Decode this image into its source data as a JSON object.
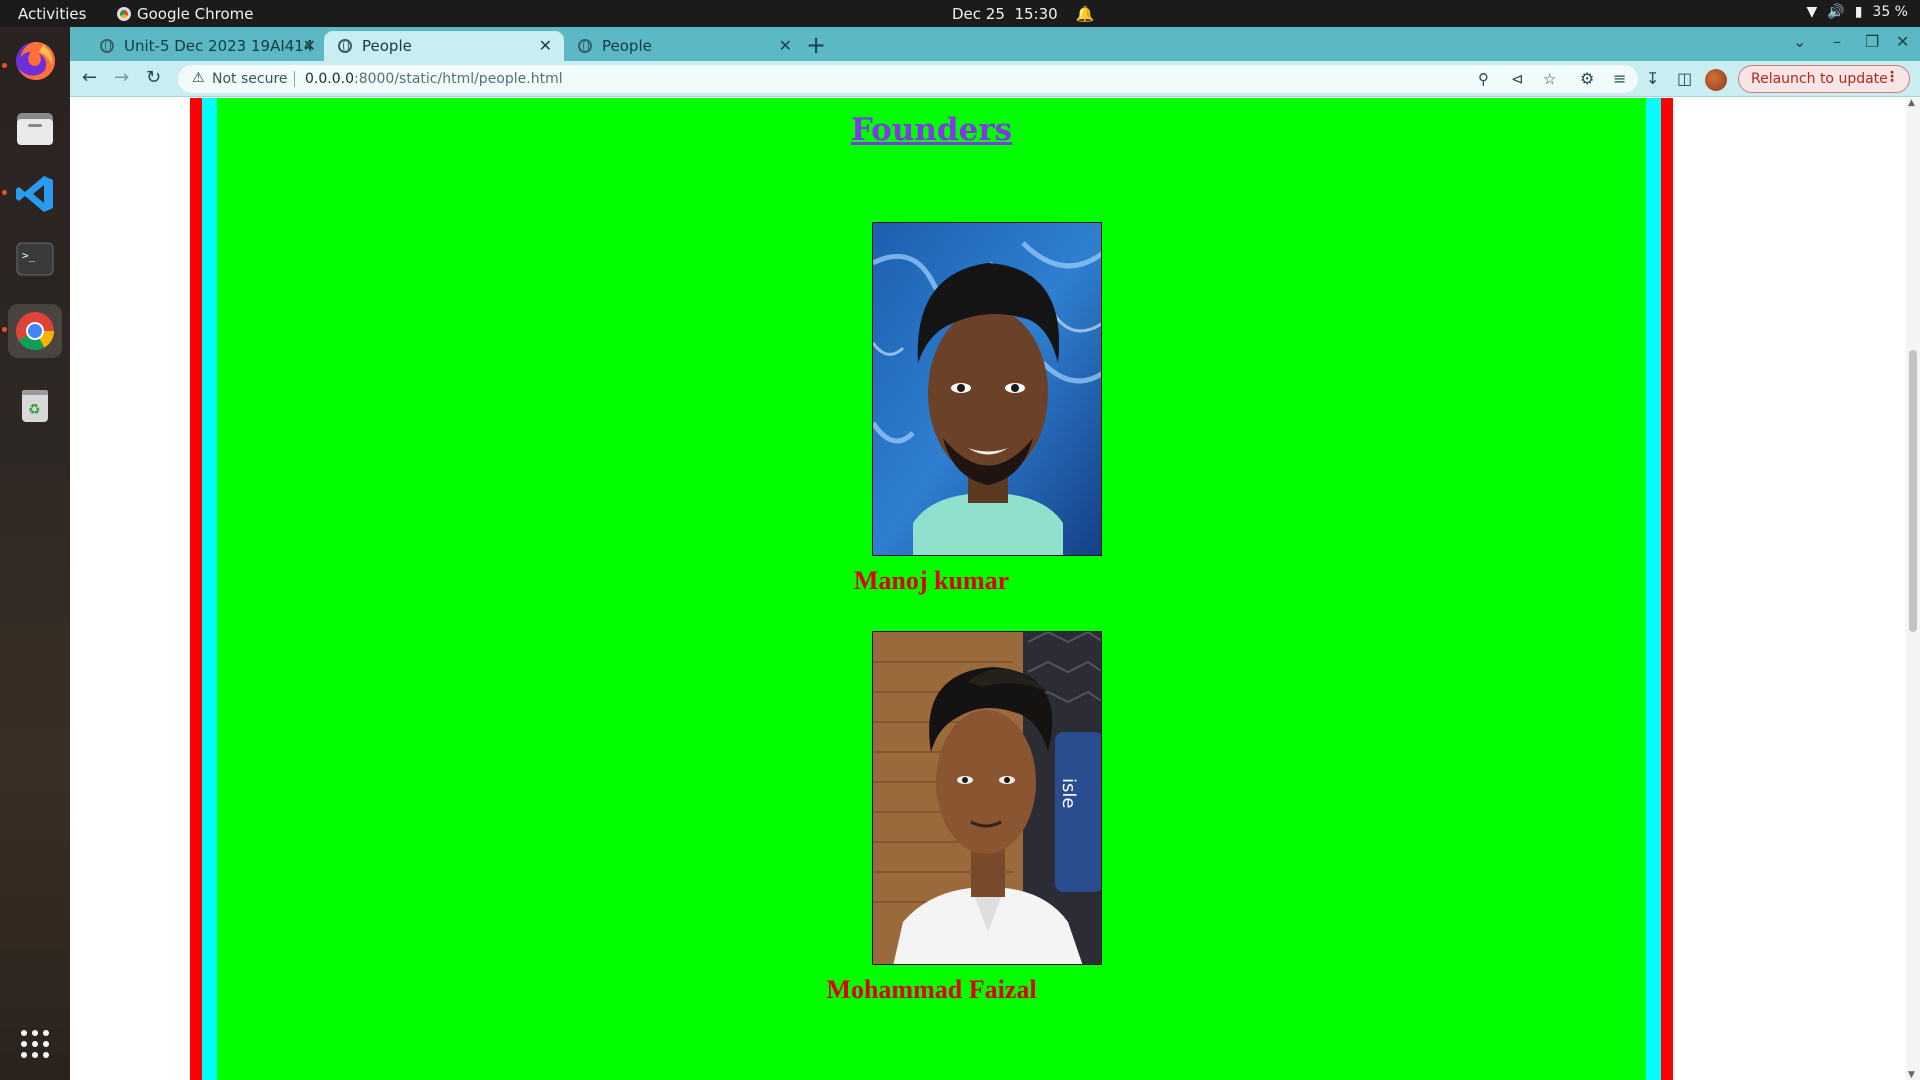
{
  "system": {
    "activities": "Activities",
    "app_name": "Google Chrome",
    "date": "Dec 25",
    "time": "15:30",
    "battery": "35 %"
  },
  "dock": {
    "items": [
      {
        "name": "Firefox",
        "icon": "firefox-icon"
      },
      {
        "name": "Files",
        "icon": "files-icon"
      },
      {
        "name": "Visual Studio Code",
        "icon": "vscode-icon"
      },
      {
        "name": "Terminal",
        "icon": "terminal-icon"
      },
      {
        "name": "Google Chrome",
        "icon": "chrome-icon"
      },
      {
        "name": "Trash",
        "icon": "trash-icon"
      },
      {
        "name": "Show Applications",
        "icon": "app-grid-icon"
      }
    ]
  },
  "browser": {
    "tabs": [
      {
        "title": "Unit-5 Dec 2023 19AI414",
        "active": false
      },
      {
        "title": "People",
        "active": true
      },
      {
        "title": "People",
        "active": false
      }
    ],
    "omnibox": {
      "security": "Not secure",
      "url_host": "0.0.0.0",
      "url_path": ":8000/static/html/people.html"
    },
    "relaunch_label": "Relaunch to update",
    "colors": {
      "tabstrip": "#5cb8c4",
      "toolbar": "#c9eef2"
    }
  },
  "page": {
    "heading": "Founders",
    "founders": [
      {
        "name": "Manoj kumar"
      },
      {
        "name": "Mohammad Faizal"
      }
    ],
    "colors": {
      "outer_border": "#ff0000",
      "inner_border": "#00ffff",
      "background": "#00ff00",
      "heading": "#7f39e6",
      "names": "#e00000"
    }
  }
}
